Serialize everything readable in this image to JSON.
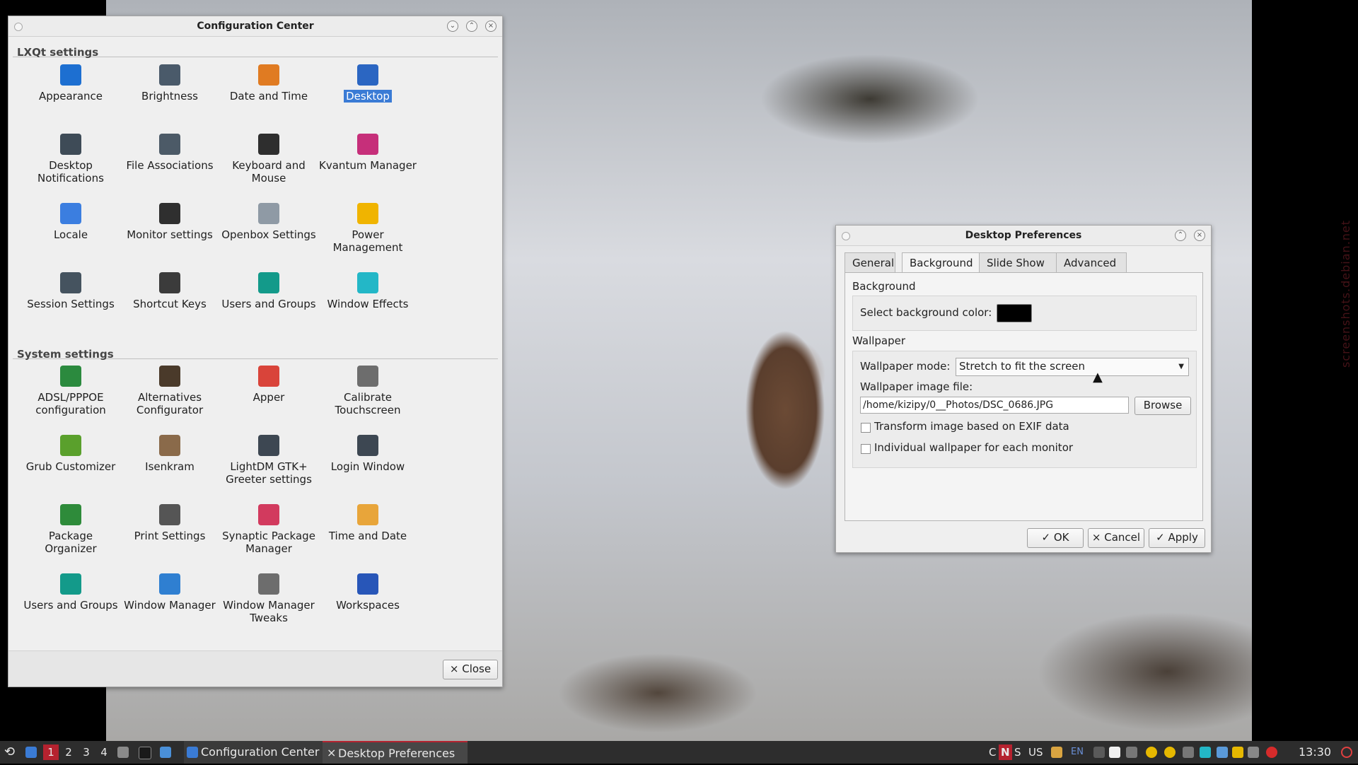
{
  "config_center": {
    "title": "Configuration Center",
    "lxqt_section": "LXQt settings",
    "system_section": "System settings",
    "lxqt_items": [
      {
        "label": "Appearance",
        "icon": "appearance-icon",
        "color": "#1d6fd1"
      },
      {
        "label": "Brightness",
        "icon": "brightness-icon",
        "color": "#4a5a6a"
      },
      {
        "label": "Date and Time",
        "icon": "clock-icon",
        "color": "#e07b22"
      },
      {
        "label": "Desktop",
        "icon": "desktop-icon",
        "color": "#2b66c2"
      },
      {
        "label": "Desktop Notifications",
        "icon": "notification-icon",
        "color": "#3e4b57"
      },
      {
        "label": "File Associations",
        "icon": "gear-icon",
        "color": "#4c5a67"
      },
      {
        "label": "Keyboard and Mouse",
        "icon": "mouse-icon",
        "color": "#2e2e2e"
      },
      {
        "label": "Kvantum Manager",
        "icon": "kvantum-icon",
        "color": "#c62f7a"
      },
      {
        "label": "Locale",
        "icon": "locale-icon",
        "color": "#3b7ee0"
      },
      {
        "label": "Monitor settings",
        "icon": "monitor-icon",
        "color": "#2f2f2f"
      },
      {
        "label": "Openbox Settings",
        "icon": "openbox-icon",
        "color": "#8f9aa5"
      },
      {
        "label": "Power Management",
        "icon": "power-icon",
        "color": "#f0b400"
      },
      {
        "label": "Session Settings",
        "icon": "gear-icon",
        "color": "#45535f"
      },
      {
        "label": "Shortcut Keys",
        "icon": "keyboard-icon",
        "color": "#3b3b3b"
      },
      {
        "label": "Users and Groups",
        "icon": "user-icon",
        "color": "#139a8a"
      },
      {
        "label": "Window Effects",
        "icon": "window-effects-icon",
        "color": "#23b7c7"
      }
    ],
    "system_items": [
      {
        "label": "ADSL/PPPOE configuration",
        "icon": "phone-icon",
        "color": "#2b8a3e"
      },
      {
        "label": "Alternatives Configurator",
        "icon": "alternatives-icon",
        "color": "#4a3a2a"
      },
      {
        "label": "Apper",
        "icon": "apper-icon",
        "color": "#d9443a"
      },
      {
        "label": "Calibrate Touchscreen",
        "icon": "touchscreen-icon",
        "color": "#6d6d6d"
      },
      {
        "label": "Grub Customizer",
        "icon": "grub-icon",
        "color": "#5aa02c"
      },
      {
        "label": "Isenkram",
        "icon": "isenkram-icon",
        "color": "#8a6a4a"
      },
      {
        "label": "LightDM GTK+ Greeter settings",
        "icon": "lightdm-icon",
        "color": "#3d4752"
      },
      {
        "label": "Login Window",
        "icon": "login-window-icon",
        "color": "#3d4752"
      },
      {
        "label": "Package Organizer",
        "icon": "package-icon",
        "color": "#2e8b3a"
      },
      {
        "label": "Print Settings",
        "icon": "printer-icon",
        "color": "#555555"
      },
      {
        "label": "Synaptic Package Manager",
        "icon": "synaptic-icon",
        "color": "#d23a5e"
      },
      {
        "label": "Time and Date",
        "icon": "clock-icon",
        "color": "#e8a53a"
      },
      {
        "label": "Users and Groups",
        "icon": "user-icon",
        "color": "#139a8a"
      },
      {
        "label": "Window Manager",
        "icon": "window-manager-icon",
        "color": "#2f7fd1"
      },
      {
        "label": "Window Manager Tweaks",
        "icon": "window-tweaks-icon",
        "color": "#6d6d6d"
      },
      {
        "label": "Workspaces",
        "icon": "workspaces-icon",
        "color": "#2856b8"
      }
    ],
    "close_label": "× Close"
  },
  "desktop_prefs": {
    "title": "Desktop Preferences",
    "tabs": [
      "General",
      "Background",
      "Slide Show",
      "Advanced"
    ],
    "active_tab": "Background",
    "background_group": "Background",
    "select_bg_color_label": "Select background color:",
    "bg_color": "#000000",
    "wallpaper_group": "Wallpaper",
    "wallpaper_mode_label": "Wallpaper mode:",
    "wallpaper_mode_value": "Stretch to fit the screen",
    "wallpaper_file_label": "Wallpaper image file:",
    "wallpaper_file_value": "/home/kizipy/0__Photos/DSC_0686.JPG",
    "browse_label": "Browse",
    "exif_label": "Transform image based on EXIF data",
    "individual_label": "Individual wallpaper for each monitor",
    "ok_label": "✓ OK",
    "cancel_label": "× Cancel",
    "apply_label": "✓ Apply"
  },
  "taskbar": {
    "desktops": [
      "1",
      "2",
      "3",
      "4"
    ],
    "active_desktop": "1",
    "tasks": [
      "Configuration Center",
      "Desktop Preferences"
    ],
    "tray_letters": [
      "C",
      "N",
      "S"
    ],
    "keyboard_layout": "US",
    "lang": "EN",
    "clock": "13:30"
  },
  "watermark": "screenshots.debian.net"
}
